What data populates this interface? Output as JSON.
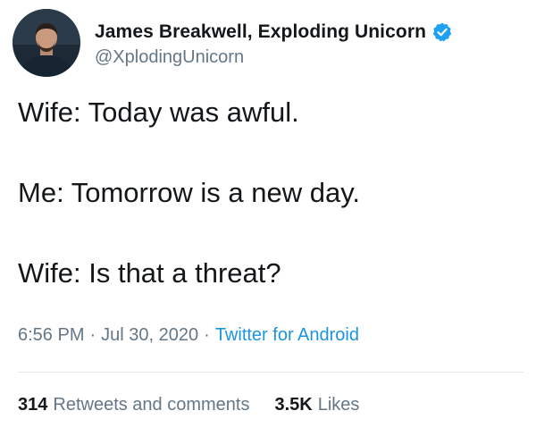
{
  "author": {
    "display_name": "James Breakwell, Exploding Unicorn",
    "handle": "@XplodingUnicorn",
    "avatar_icon": "user-avatar-photo",
    "verified_icon": "verified-badge-icon",
    "verified_color": "#1da1f2"
  },
  "tweet": {
    "lines": [
      "Wife: Today was awful.",
      "Me: Tomorrow is a new day.",
      "Wife: Is that a threat?"
    ],
    "time": "6:56 PM",
    "date": "Jul 30, 2020",
    "separator": "·",
    "source": "Twitter for Android",
    "source_color": "#1b95e0"
  },
  "stats": {
    "retweets_count": "314",
    "retweets_label": "Retweets and comments",
    "likes_count": "3.5K",
    "likes_label": "Likes"
  }
}
